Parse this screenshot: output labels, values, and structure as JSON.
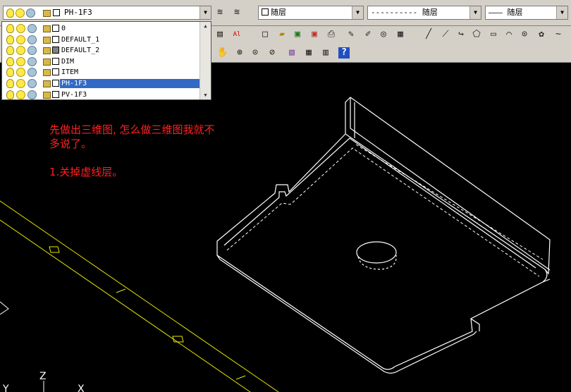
{
  "layer_control": {
    "current_layer": "PH-1F3",
    "layers": [
      {
        "name": "0",
        "color": "#ffffff",
        "selected": false
      },
      {
        "name": "DEFAULT_1",
        "color": "#ffffff",
        "selected": false
      },
      {
        "name": "DEFAULT_2",
        "color": "#808080",
        "selected": false
      },
      {
        "name": "DIM",
        "color": "#ffffff",
        "selected": false
      },
      {
        "name": "ITEM",
        "color": "#ffffff",
        "selected": false
      },
      {
        "name": "PH-1F3",
        "color": "#ffffff",
        "selected": true
      },
      {
        "name": "PV-1F3",
        "color": "#ffffff",
        "selected": false
      }
    ]
  },
  "properties": {
    "color": "随层",
    "linetype_dash": "----------",
    "linetype": "随层",
    "lineweight_line": "———",
    "lineweight": "随层"
  },
  "annotation": {
    "line1": "先做出三维图, 怎么做三维图我就不多说了。",
    "line2": "1.关掉虚线层。",
    "color": "#ff2020"
  },
  "ucs": {
    "z_label": "Z",
    "y_label": "Y",
    "x_label": "X"
  }
}
